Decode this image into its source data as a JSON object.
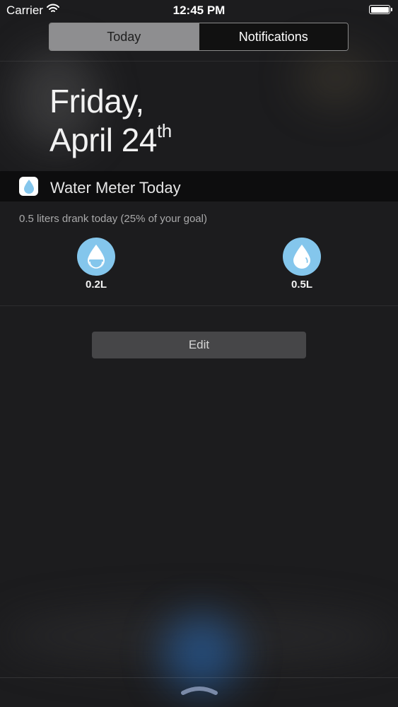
{
  "status_bar": {
    "carrier": "Carrier",
    "time": "12:45 PM",
    "icons": [
      "wifi-icon",
      "battery-icon"
    ]
  },
  "segmented_control": {
    "tabs": [
      {
        "label": "Today",
        "selected": true
      },
      {
        "label": "Notifications",
        "selected": false
      }
    ]
  },
  "date_header": {
    "weekday": "Friday,",
    "month_day": "April 24",
    "ordinal_suffix": "th"
  },
  "widget": {
    "title": "Water Meter Today",
    "icon": "water-drop-icon",
    "summary": "0.5 liters drank today (25% of your goal)",
    "buttons": [
      {
        "label": "0.2L",
        "icon": "partial-drop-icon"
      },
      {
        "label": "0.5L",
        "icon": "full-drop-icon"
      }
    ],
    "accent_color": "#84c6ec"
  },
  "edit": {
    "label": "Edit"
  }
}
